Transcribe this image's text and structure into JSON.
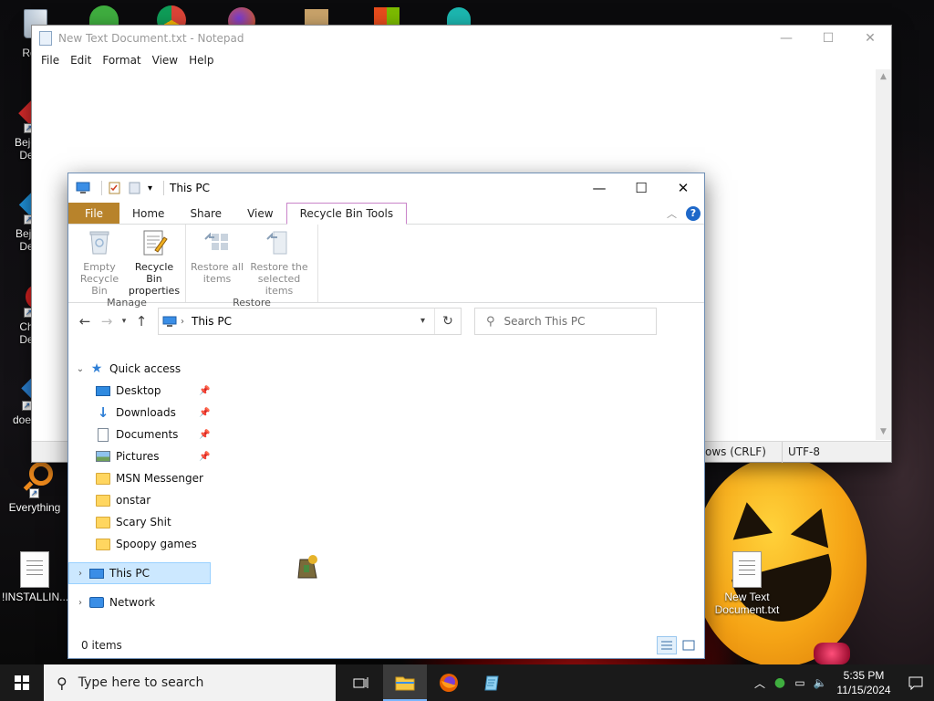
{
  "desktop": {
    "icons": [
      {
        "label": "Recy",
        "kind": "recycle"
      },
      {
        "label": "Bejev De",
        "kind": "gem"
      },
      {
        "label": "Beje De",
        "kind": "gem"
      },
      {
        "label": "Ch De",
        "kind": "chrome"
      },
      {
        "label": "does",
        "kind": "gem"
      },
      {
        "label": "Everything",
        "kind": "everything"
      },
      {
        "label": "!INSTALLIN...",
        "kind": "doc"
      },
      {
        "label": "New Text Document.txt",
        "kind": "doc"
      }
    ]
  },
  "notepad": {
    "title": "New Text Document.txt - Notepad",
    "menu": [
      "File",
      "Edit",
      "Format",
      "View",
      "Help"
    ],
    "status_line_ending": "ows (CRLF)",
    "status_encoding": "UTF-8"
  },
  "explorer": {
    "title": "This PC",
    "tabs": {
      "file": "File",
      "home": "Home",
      "share": "Share",
      "view": "View",
      "tools": "Recycle Bin Tools"
    },
    "ribbon": {
      "manage": {
        "name": "Manage",
        "empty": "Empty Recycle Bin",
        "properties": "Recycle Bin properties"
      },
      "restore": {
        "name": "Restore",
        "restore_all": "Restore all items",
        "restore_selected": "Restore the selected items"
      }
    },
    "address": "This PC",
    "search_placeholder": "Search This PC",
    "nav": {
      "quick_access": "Quick access",
      "items": [
        {
          "label": "Desktop",
          "pinned": true,
          "icon": "desktop-icon"
        },
        {
          "label": "Downloads",
          "pinned": true,
          "icon": "download-icon"
        },
        {
          "label": "Documents",
          "pinned": true,
          "icon": "documents-icon"
        },
        {
          "label": "Pictures",
          "pinned": true,
          "icon": "pictures-icon"
        },
        {
          "label": "MSN Messenger",
          "pinned": false,
          "icon": "folder-icon"
        },
        {
          "label": "onstar",
          "pinned": false,
          "icon": "folder-icon"
        },
        {
          "label": "Scary Shit",
          "pinned": false,
          "icon": "folder-icon"
        },
        {
          "label": "Spoopy games",
          "pinned": false,
          "icon": "folder-icon"
        }
      ],
      "this_pc": "This PC",
      "network": "Network"
    },
    "status": "0 items"
  },
  "taskbar": {
    "search_placeholder": "Type here to search",
    "time": "5:35 PM",
    "date": "11/15/2024"
  },
  "colors": {
    "file_tab": "#b8832b",
    "tools_tab_border": "#c984c9",
    "selection": "#cce8ff",
    "taskbar": "#1a1a1a",
    "pumpkin": "#f6a516"
  }
}
